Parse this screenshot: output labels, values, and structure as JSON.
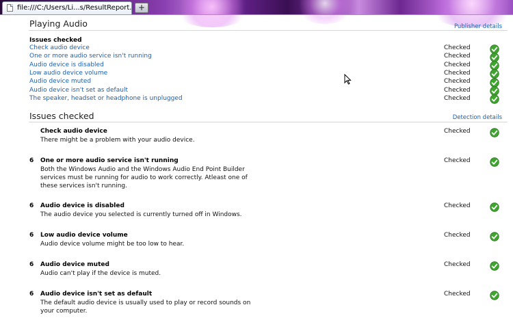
{
  "browser": {
    "tab_title": "file:///C:/Users/Li...s/ResultReport.htm",
    "new_tab_label": "+"
  },
  "playing_audio": {
    "title": "Playing Audio",
    "publisher_link": "Publisher details",
    "issues_label": "Issues checked",
    "items": [
      {
        "label": "Check audio device",
        "status": "Checked"
      },
      {
        "label": "One or more audio service isn't running",
        "status": "Checked"
      },
      {
        "label": "Audio device is disabled",
        "status": "Checked"
      },
      {
        "label": "Low audio device volume",
        "status": "Checked"
      },
      {
        "label": "Audio device muted",
        "status": "Checked"
      },
      {
        "label": "Audio device isn't set as default",
        "status": "Checked"
      },
      {
        "label": "The speaker, headset or headphone is unplugged",
        "status": "Checked"
      }
    ]
  },
  "issues_checked": {
    "title": "Issues checked",
    "detection_link": "Detection details",
    "details": [
      {
        "num": "",
        "title": "Check audio device",
        "desc": "There might be a problem with your audio device.",
        "status": "Checked"
      },
      {
        "num": "6",
        "title": "One or more audio service isn't running",
        "desc": "Both the Windows Audio and the Windows Audio End Point Builder services must be running for audio to work correctly. Atleast one of these services isn't running.",
        "status": "Checked"
      },
      {
        "num": "6",
        "title": "Audio device is disabled",
        "desc": "The audio device you selected is currently turned off in Windows.",
        "status": "Checked"
      },
      {
        "num": "6",
        "title": "Low audio device volume",
        "desc": "Audio device volume might be too low to hear.",
        "status": "Checked"
      },
      {
        "num": "6",
        "title": "Audio device muted",
        "desc": "Audio can't play if the device is muted.",
        "status": "Checked"
      },
      {
        "num": "6",
        "title": "Audio device isn't set as default",
        "desc": "The default audio device is usually used to play or record sounds on your computer.",
        "status": "Checked"
      }
    ]
  },
  "icons": {
    "check": "green-checkmark-icon",
    "page": "page-icon",
    "cursor": "mouse-pointer-icon"
  },
  "colors": {
    "link": "#1a5fb4",
    "check_green": "#3fa52f"
  }
}
